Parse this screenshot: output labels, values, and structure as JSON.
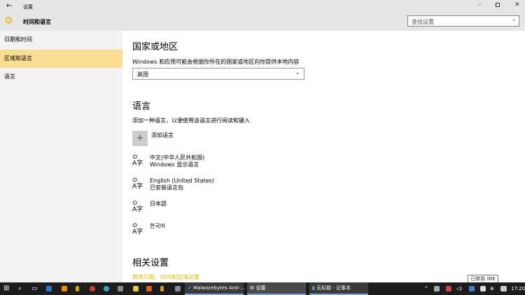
{
  "window": {
    "title": "设置",
    "back_icon": "arrow-left-icon",
    "header": "时间和语言",
    "search_placeholder": "查找设置"
  },
  "sidebar": {
    "items": [
      {
        "label": "日期和时间"
      },
      {
        "label": "区域和语言",
        "selected": true
      },
      {
        "label": "语言"
      }
    ]
  },
  "region": {
    "heading": "国家或地区",
    "description": "Windows 和应用可能会根据你所在的国家或地区向你提供本地内容",
    "selected": "英国"
  },
  "language": {
    "heading": "语言",
    "description": "添加一种语言，以便使用该语言进行阅读和键入",
    "add_label": "添加语言",
    "items": [
      {
        "name": "中文(中华人民共和国)",
        "sub": "Windows 显示语言"
      },
      {
        "name": "English (United States)",
        "sub": "已安装语言包"
      },
      {
        "name": "日本語",
        "sub": ""
      },
      {
        "name": "한국어",
        "sub": ""
      }
    ]
  },
  "related": {
    "heading": "相关设置",
    "link": "其他日期、时间和区域设置"
  },
  "tooltip": "已禁用 IME",
  "taskbar": {
    "tasks": [
      {
        "label": "Malwarebytes Anti-..."
      },
      {
        "label": "设置"
      },
      {
        "label": "无标题 - 记事本"
      }
    ],
    "clock": "17:20"
  },
  "colors": {
    "accent": "#f9dc90",
    "link": "#e6b800",
    "taskbar": "#1c1c1c"
  }
}
